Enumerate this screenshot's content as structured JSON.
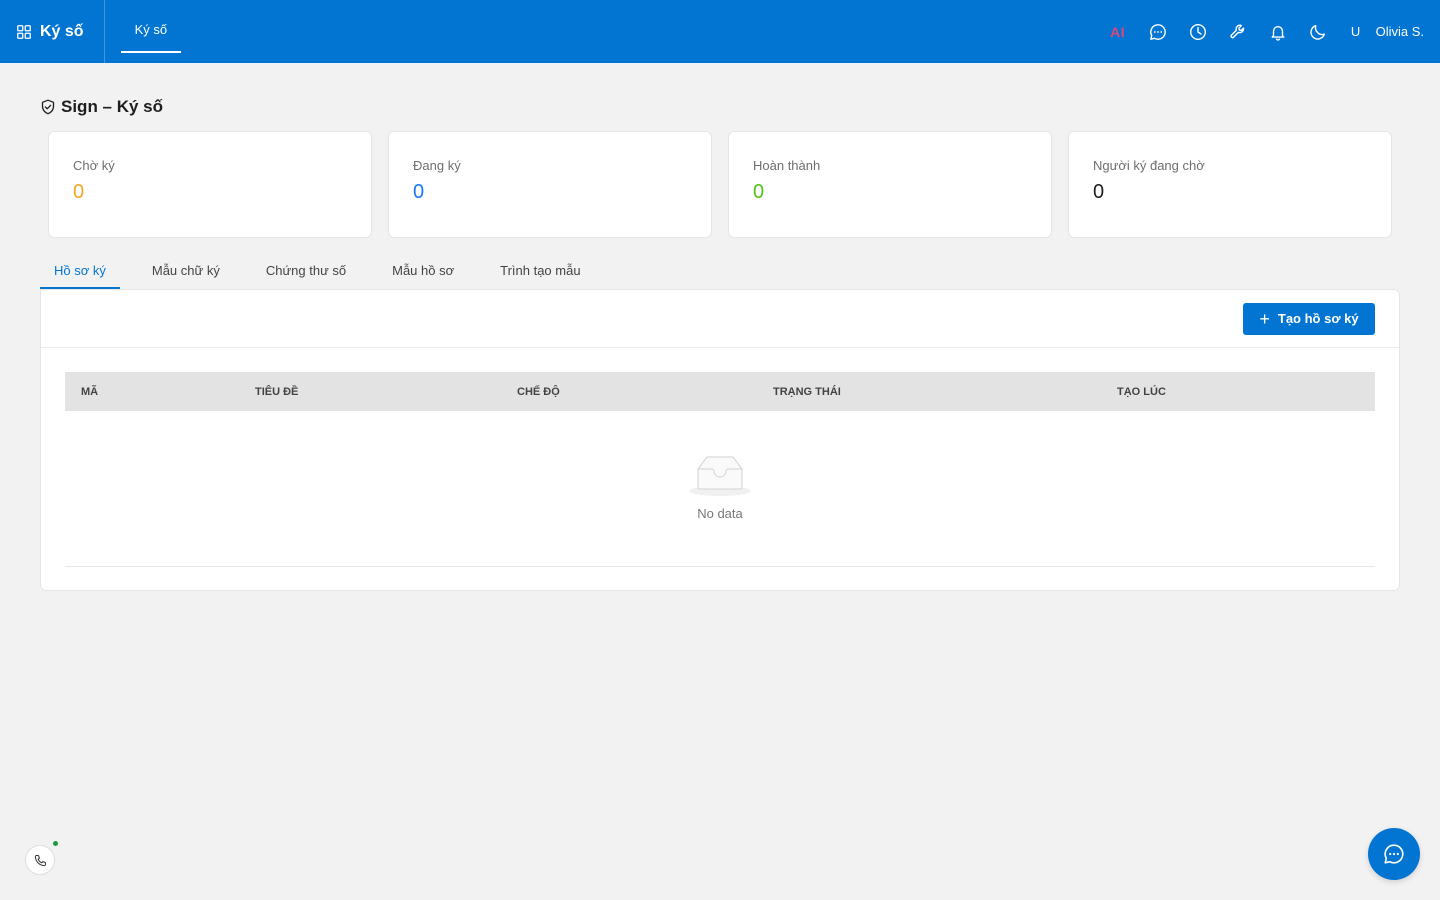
{
  "app": {
    "name": "Ký số"
  },
  "topnav": {
    "tabs": [
      {
        "label": "Ký số",
        "active": true
      }
    ]
  },
  "header": {
    "ai_label": "AI",
    "icons": [
      "chat-icon",
      "clock-icon",
      "wrench-icon",
      "bell-icon",
      "moon-icon"
    ],
    "user_initial": "U",
    "user_name": "Olivia S."
  },
  "page": {
    "title": "Sign – Ký số",
    "title_icon": "shield-check-icon"
  },
  "stats": [
    {
      "label": "Chờ ký",
      "value": "0",
      "color": "#f5a623"
    },
    {
      "label": "Đang ký",
      "value": "0",
      "color": "#1677ff"
    },
    {
      "label": "Hoàn thành",
      "value": "0",
      "color": "#52c41a"
    },
    {
      "label": "Người ký đang chờ",
      "value": "0",
      "color": "#1e1e1e"
    }
  ],
  "tabs": [
    {
      "label": "Hồ sơ ký",
      "active": true
    },
    {
      "label": "Mẫu chữ ký",
      "active": false
    },
    {
      "label": "Chứng thư số",
      "active": false
    },
    {
      "label": "Mẫu hồ sơ",
      "active": false
    },
    {
      "label": "Trình tạo mẫu",
      "active": false
    }
  ],
  "toolbar": {
    "create_label": "Tạo hồ sơ ký"
  },
  "table": {
    "columns": [
      "MÃ",
      "TIÊU ĐỀ",
      "CHẾ ĐỘ",
      "TRẠNG THÁI",
      "TẠO LÚC"
    ],
    "empty_text": "No data"
  },
  "colors": {
    "primary": "#0275d3",
    "ai": "#e0457b",
    "online": "#1a9c3e"
  }
}
